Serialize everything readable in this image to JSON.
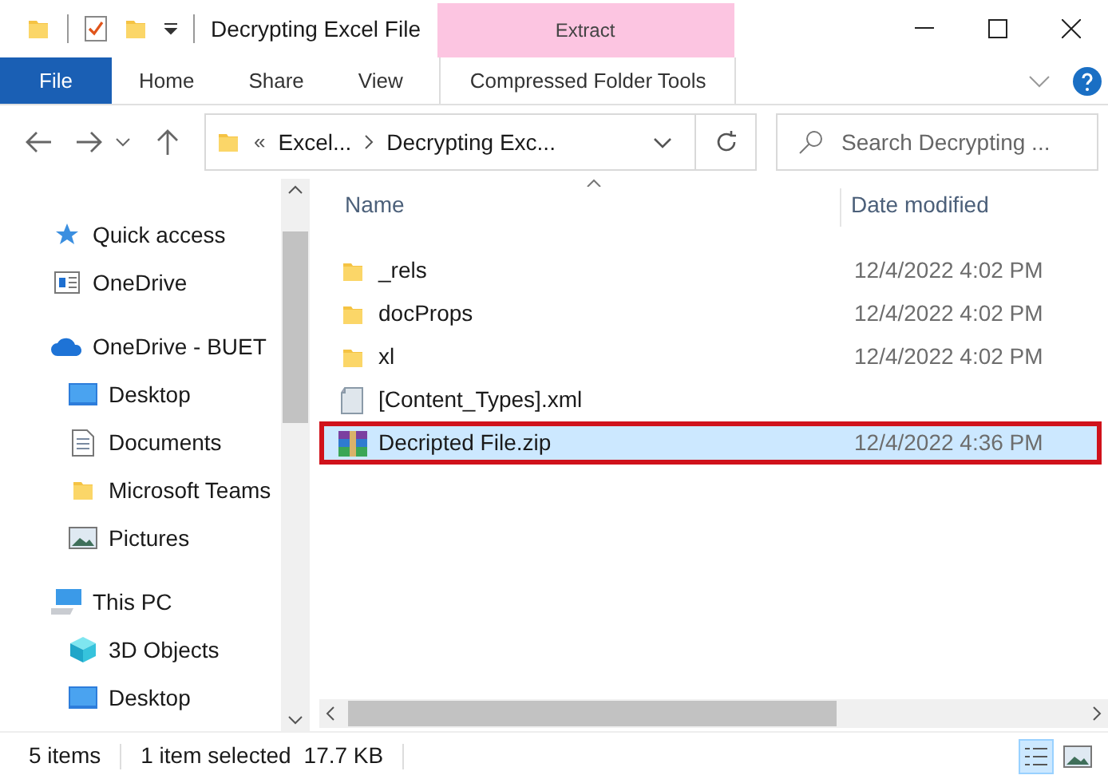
{
  "window": {
    "title": "Decrypting Excel File",
    "context_tab_group": "Extract"
  },
  "ribbon_tabs": [
    {
      "label": "File",
      "kind": "file",
      "selected": false
    },
    {
      "label": "Home",
      "kind": "tab",
      "selected": false
    },
    {
      "label": "Share",
      "kind": "tab",
      "selected": false
    },
    {
      "label": "View",
      "kind": "tab",
      "selected": false
    },
    {
      "label": "Compressed Folder Tools",
      "kind": "context",
      "selected": false
    }
  ],
  "address_bar": {
    "overflow": "«",
    "crumbs": [
      "Excel...",
      "Decrypting Exc..."
    ]
  },
  "search": {
    "placeholder": "Search Decrypting ..."
  },
  "sidebar": {
    "items": [
      {
        "label": "Quick access",
        "kind": "star"
      },
      {
        "label": "OneDrive",
        "kind": "onedrive"
      },
      {
        "label": "OneDrive - BUET",
        "kind": "cloud",
        "children": [
          {
            "label": "Desktop",
            "kind": "desktop"
          },
          {
            "label": "Documents",
            "kind": "document"
          },
          {
            "label": "Microsoft Teams",
            "kind": "folder"
          },
          {
            "label": "Pictures",
            "kind": "pictures"
          }
        ]
      },
      {
        "label": "This PC",
        "kind": "pc",
        "children": [
          {
            "label": "3D Objects",
            "kind": "cube"
          },
          {
            "label": "Desktop",
            "kind": "desktop"
          }
        ]
      }
    ]
  },
  "file_list": {
    "columns": [
      "Name",
      "Date modified"
    ],
    "rows": [
      {
        "name": "_rels",
        "kind": "folder",
        "date": "12/4/2022 4:02 PM",
        "selected": false
      },
      {
        "name": "docProps",
        "kind": "folder",
        "date": "12/4/2022 4:02 PM",
        "selected": false
      },
      {
        "name": "xl",
        "kind": "folder",
        "date": "12/4/2022 4:02 PM",
        "selected": false
      },
      {
        "name": "[Content_Types].xml",
        "kind": "xml",
        "selected": false
      },
      {
        "name": "Decripted File.zip",
        "kind": "zip",
        "date": "12/4/2022 4:36 PM",
        "selected": true
      }
    ]
  },
  "status_bar": {
    "count": "5 items",
    "selection": "1 item selected",
    "size": "17.7 KB"
  }
}
